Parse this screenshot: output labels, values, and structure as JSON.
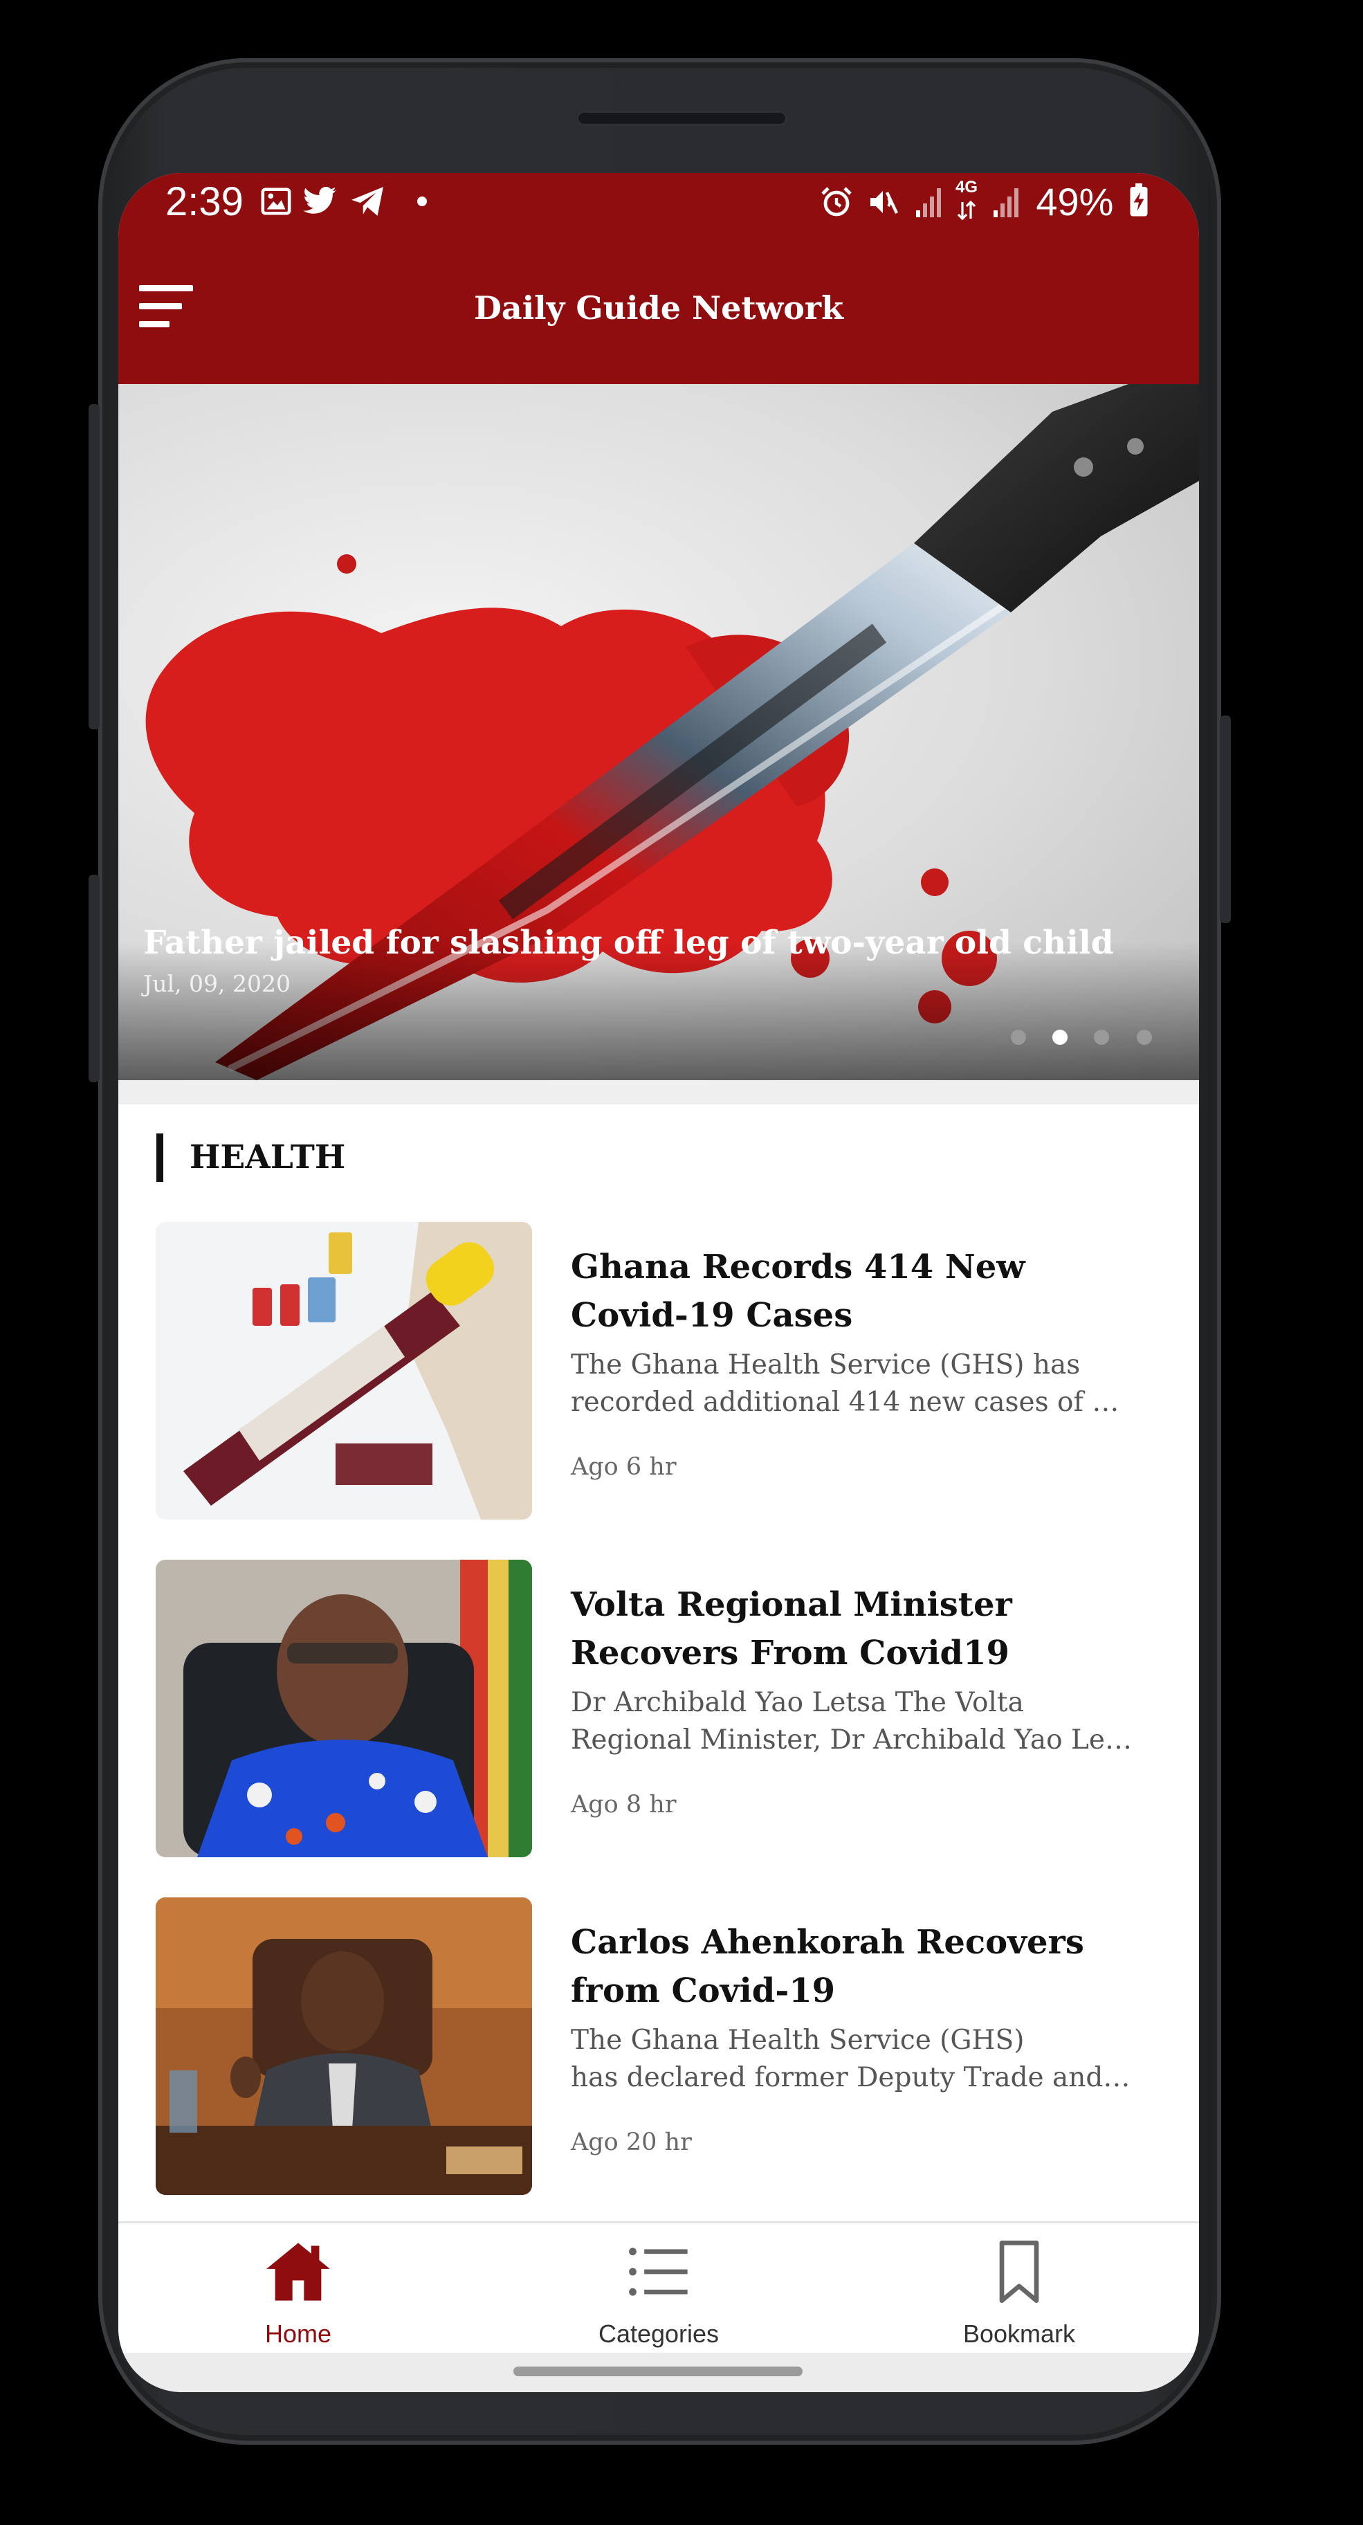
{
  "status_bar": {
    "time": "2:39",
    "battery": "49%",
    "network": "4G",
    "icons": [
      "image-icon",
      "twitter-icon",
      "telegram-icon",
      "dot-icon",
      "alarm-icon",
      "mute-icon",
      "signal-icon",
      "signal-icon",
      "battery-charging-icon"
    ]
  },
  "header": {
    "title": "Daily Guide Network",
    "menu_icon": "hamburger-menu-icon"
  },
  "hero": {
    "title": "Father jailed for slashing off leg of two-year old child",
    "date": "Jul, 09, 2020",
    "slides_count": 4,
    "active_slide": 2
  },
  "section": {
    "title": "HEALTH"
  },
  "articles": [
    {
      "title": "Ghana Records 414 New Covid-19 Cases",
      "snippet_line1": "The Ghana Health Service (GHS) has",
      "snippet_line2": "recorded additional 414 new cases of Co...",
      "time": "Ago 6 hr"
    },
    {
      "title": "Volta Regional Minister Recovers From Covid19",
      "snippet_line1": "Dr Archibald Yao Letsa The Volta",
      "snippet_line2": "Regional Minister, Dr Archibald Yao Let...",
      "time": "Ago 8 hr"
    },
    {
      "title": "Carlos Ahenkorah Recovers from Covid-19",
      "snippet_line1": "The Ghana Health Service (GHS)",
      "snippet_line2": "has declared former Deputy Trade and I...",
      "time": "Ago 20 hr"
    }
  ],
  "bottom_nav": {
    "items": [
      {
        "label": "Home",
        "icon": "home-icon",
        "active": true
      },
      {
        "label": "Categories",
        "icon": "list-icon",
        "active": false
      },
      {
        "label": "Bookmark",
        "icon": "bookmark-icon",
        "active": false
      }
    ]
  },
  "colors": {
    "brand_red": "#8f0c0f",
    "background": "#ffffff",
    "text_dark": "#111111",
    "text_muted": "#555555"
  }
}
